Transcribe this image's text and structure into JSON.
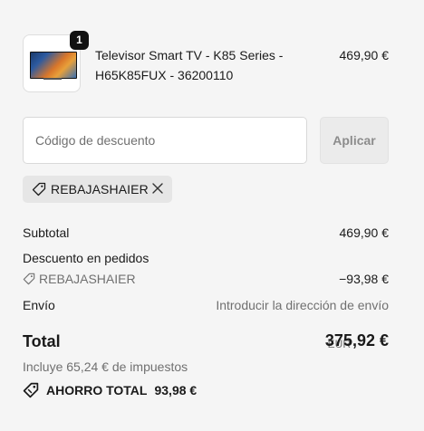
{
  "cart_item": {
    "quantity": "1",
    "title_line1": "Televisor Smart TV - K85 Series -",
    "title_line2": "H65K85FUX - 36200110",
    "price": "469,90 €"
  },
  "discount": {
    "placeholder": "Código de descuento",
    "apply_label": "Aplicar",
    "applied_code": "REBAJASHAIER"
  },
  "summary": {
    "subtotal_label": "Subtotal",
    "subtotal_value": "469,90 €",
    "order_discount_label": "Descuento en pedidos",
    "discount_code": "REBAJASHAIER",
    "discount_value": "−93,98 €",
    "shipping_label": "Envío",
    "shipping_value": "Introducir la dirección de envío",
    "total_label": "Total",
    "total_currency": "EUR",
    "total_value": "375,92 €",
    "taxes_text": "Incluye 65,24 € de impuestos",
    "savings_label": "AHORRO TOTAL",
    "savings_value": "93,98 €"
  },
  "colors": {
    "background": "#f5f5f5",
    "badge": "#111111",
    "muted_text": "#707070",
    "chip_bg": "#e6e6e6",
    "disabled_button_bg": "#ebebeb"
  },
  "icons": [
    "tag-icon",
    "close-icon",
    "savings-tag-icon"
  ]
}
